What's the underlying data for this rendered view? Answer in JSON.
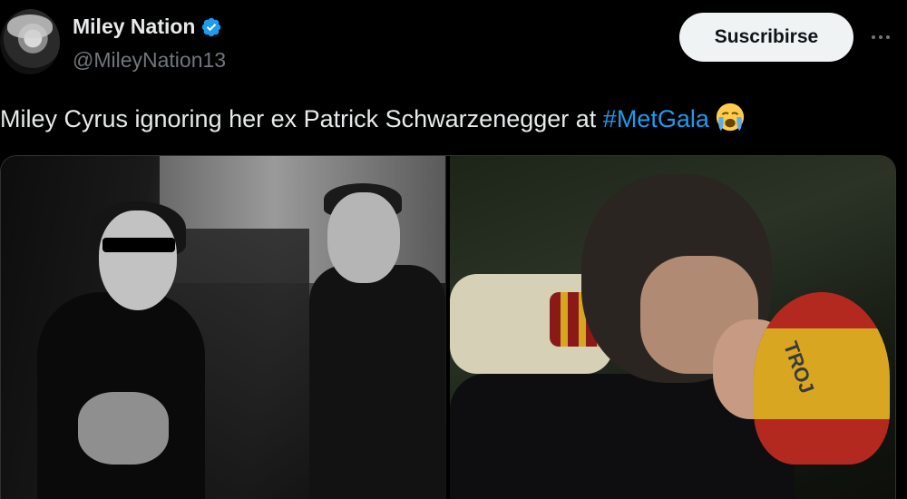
{
  "account": {
    "display_name": "Miley Nation",
    "handle": "@MileyNation13",
    "verified": true
  },
  "header": {
    "subscribe_label": "Suscribirse",
    "more_icon": "more-horizontal-icon"
  },
  "tweet": {
    "text": "Miley Cyrus ignoring her ex Patrick Schwarzenegger at ",
    "hashtag": "#MetGala",
    "emoji": "loudly-crying-face"
  },
  "media": {
    "photos": [
      {
        "description_icon": "photo-left"
      },
      {
        "description_icon": "photo-right",
        "hat_text": "TROJ"
      }
    ]
  },
  "colors": {
    "background": "#000000",
    "text": "#e7e9ea",
    "secondary_text": "#71767b",
    "link": "#1d9bf0",
    "verified": "#1d9bf0",
    "button_bg": "#eff3f4"
  }
}
